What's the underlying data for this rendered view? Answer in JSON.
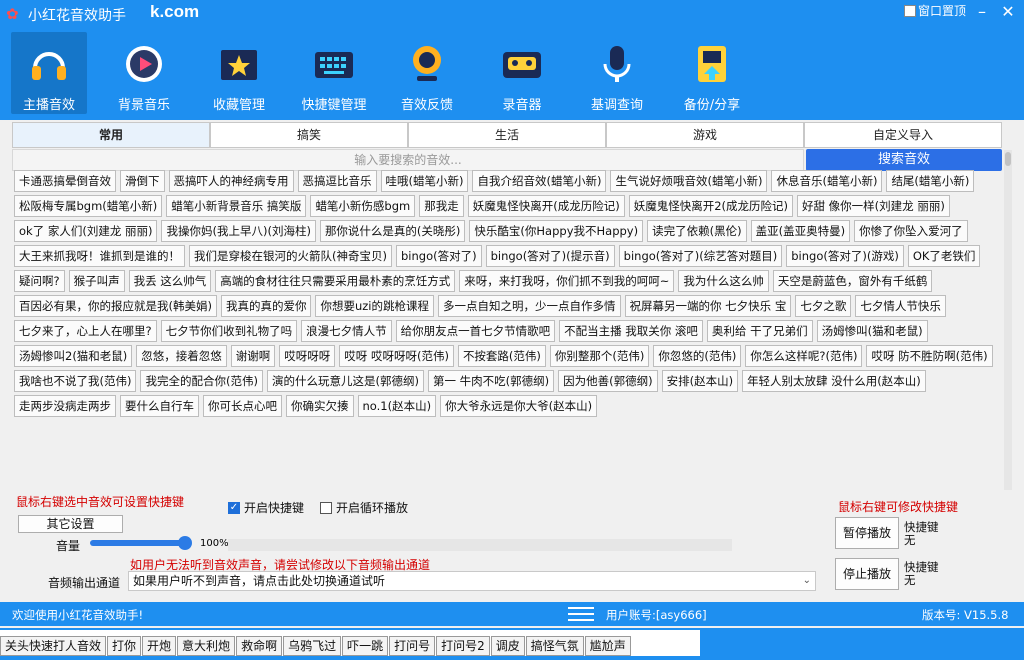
{
  "window": {
    "title": "小红花音效助手",
    "watermark": "k.com",
    "pin_label": "窗口置顶",
    "minimize": "–",
    "close": "✕"
  },
  "toolbar": {
    "items": [
      {
        "label": "主播音效",
        "icon": "headphones-icon",
        "active": true
      },
      {
        "label": "背景音乐",
        "icon": "music-player-icon",
        "active": false
      },
      {
        "label": "收藏管理",
        "icon": "star-folder-icon",
        "active": false
      },
      {
        "label": "快捷键管理",
        "icon": "keyboard-icon",
        "active": false
      },
      {
        "label": "音效反馈",
        "icon": "feedback-icon",
        "active": false
      },
      {
        "label": "录音器",
        "icon": "cassette-icon",
        "active": false
      },
      {
        "label": "基调查询",
        "icon": "microphone-icon",
        "active": false
      },
      {
        "label": "备份/分享",
        "icon": "backup-icon",
        "active": false
      }
    ]
  },
  "tabs": [
    {
      "label": "常用",
      "active": true
    },
    {
      "label": "搞笑",
      "active": false
    },
    {
      "label": "生活",
      "active": false
    },
    {
      "label": "游戏",
      "active": false
    },
    {
      "label": "自定义导入",
      "active": false
    }
  ],
  "search": {
    "placeholder": "输入要搜索的音效...",
    "button": "搜索音效"
  },
  "sounds": [
    "卡通恶搞晕倒音效",
    "滑倒下",
    "恶搞吓人的神经病专用",
    "恶搞逗比音乐",
    "哇哦(蜡笔小新)",
    "自我介绍音效(蜡笔小新)",
    "生气说好烦哦音效(蜡笔小新)",
    "休息音乐(蜡笔小新)",
    "结尾(蜡笔小新)",
    "松阪梅专属bgm(蜡笔小新)",
    "蜡笔小新背景音乐 搞笑版",
    "蜡笔小新伤感bgm",
    "那我走",
    "妖魔鬼怪快离开(成龙历险记)",
    "妖魔鬼怪快离开2(成龙历险记)",
    "好甜 像你一样(刘建龙 丽丽)",
    "ok了 家人们(刘建龙 丽丽)",
    "我操你妈(我上早八)(刘海柱)",
    "那你说什么是真的(关晓彤)",
    "快乐酷宝(你Happy我不Happy)",
    "读完了依赖(黑伦)",
    "盖亚(盖亚奥特曼)",
    "你惨了你坠入爱河了",
    "大王来抓我呀！谁抓到是谁的！",
    "我们是穿梭在银河的火箭队(神奇宝贝)",
    "bingo(答对了)",
    "bingo(答对了)(提示音)",
    "bingo(答对了)(综艺答对题目)",
    "bingo(答对了)(游戏)",
    "OK了老铁们",
    "疑问啊?",
    "猴子叫声",
    "我丢 这么帅气",
    "高端的食材往往只需要采用最朴素的烹饪方式",
    "来呀，来打我呀，你们抓不到我的呵呵~",
    "我为什么这么帅",
    "天空是蔚蓝色，窗外有千纸鹤",
    "百因必有果，你的报应就是我(韩美娟)",
    "我真的真的爱你",
    "你想要uzi的跳枪课程",
    "多一点自知之明，少一点自作多情",
    "祝屏幕另一端的你 七夕快乐 宝",
    "七夕之歌",
    "七夕情人节快乐",
    "七夕来了，心上人在哪里?",
    "七夕节你们收到礼物了吗",
    "浪漫七夕情人节",
    "给你朋友点一首七夕节情歌吧",
    "不配当主播 我取关你 滚吧",
    "奥利给 干了兄弟们",
    "汤姆惨叫(猫和老鼠)",
    "汤姆惨叫2(猫和老鼠)",
    "忽悠，接着忽悠",
    "谢谢啊",
    "哎呀呀呀",
    "哎呀 哎呀呀呀(范伟)",
    "不按套路(范伟)",
    "你别整那个(范伟)",
    "你忽悠的(范伟)",
    "你怎么这样呢?(范伟)",
    "哎呀 防不胜防啊(范伟)",
    "我啥也不说了我(范伟)",
    "我完全的配合你(范伟)",
    "演的什么玩意儿这是(郭德纲)",
    "第一 牛肉不吃(郭德纲)",
    "因为他善(郭德纲)",
    "安排(赵本山)",
    "年轻人别太放肆 没什么用(赵本山)",
    "走两步没病走两步",
    "要什么自行车",
    "你可长点心吧",
    "你确实欠揍",
    "no.1(赵本山)",
    "你大爷永远是你大爷(赵本山)"
  ],
  "controls": {
    "hint_left": "鼠标右键选中音效可设置快捷键",
    "hint_right": "鼠标右键可修改快捷键",
    "other_settings": "其它设置",
    "enable_hotkey": "开启快捷键",
    "enable_hotkey_checked": true,
    "loop_play": "开启循环播放",
    "loop_play_checked": false,
    "volume_label": "音量",
    "volume_value": "100%",
    "output_hint": "如用户无法听到音效声音，请尝试修改以下音频输出通道",
    "output_label": "音频输出通道",
    "output_value": "如果用户听不到声音，请点击此处切换通道试听",
    "pause_button": "暂停播放",
    "stop_button": "停止播放",
    "shortcut_label": "快捷键",
    "shortcut_none": "无"
  },
  "status": {
    "welcome": "欢迎使用小红花音效助手!",
    "account": "用户账号:[asy666]",
    "version": "版本号: V15.5.8"
  },
  "bottom_strip": [
    "关头快速打人音效",
    "打你",
    "开炮",
    "意大利炮",
    "救命啊",
    "乌鸦飞过",
    "吓一跳",
    "打问号",
    "打问号2",
    "调皮",
    "搞怪气氛",
    "尴尬声"
  ],
  "colors": {
    "brand": "#1e8ff0",
    "search_button": "#2c6fe6",
    "hint": "#d40000"
  }
}
